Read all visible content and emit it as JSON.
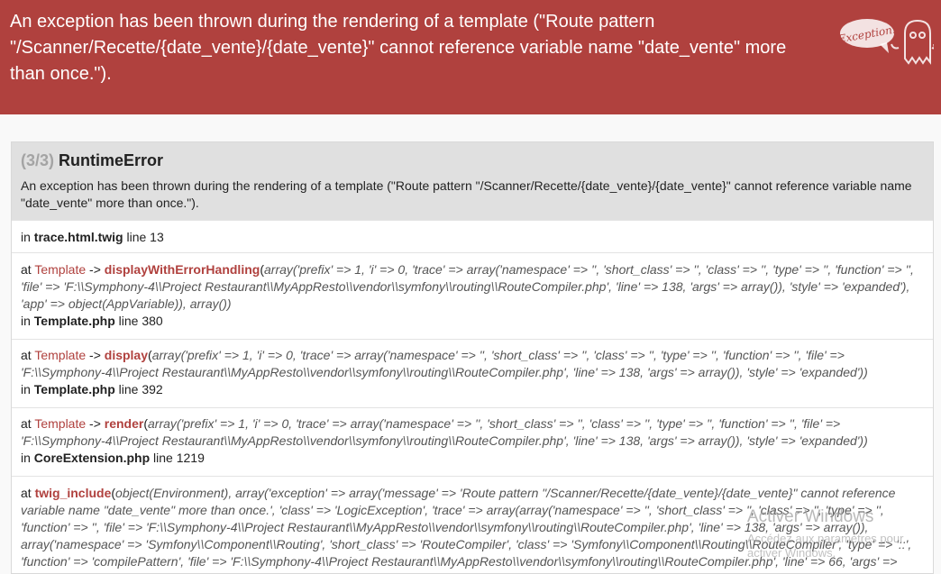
{
  "header": {
    "message": "An exception has been thrown during the rendering of a template (\"Route pattern \"/Scanner/Recette/{date_vente}/{date_vente}\" cannot reference variable name \"date_vente\" more than once.\").",
    "badge_text": "Exception!"
  },
  "trace": {
    "count": "(3/3)",
    "title": "RuntimeError",
    "message": "An exception has been thrown during the rendering of a template (\"Route pattern \"/Scanner/Recette/{date_vente}/{date_vente}\" cannot reference variable name \"date_vente\" more than once.\").",
    "first": {
      "in": "in",
      "file": "trace.html.twig",
      "line": "line 13"
    },
    "entries": [
      {
        "at": "at",
        "class": "Template",
        "arrow": " -> ",
        "function": "displayWithErrorHandling",
        "args_text": "array('prefix' => 1, 'i' => 0, 'trace' => array('namespace' => '', 'short_class' => '', 'class' => '', 'type' => '', 'function' => '', 'file' => 'F:\\\\Symphony-4\\\\Project Restaurant\\\\MyAppResto\\\\vendor\\\\symfony\\\\routing\\\\RouteCompiler.php', 'line' => 138, 'args' => array()), 'style' => 'expanded'), 'app' => object(AppVariable)), array())",
        "in": "in",
        "file": "Template.php",
        "line": "line 380"
      },
      {
        "at": "at",
        "class": "Template",
        "arrow": " -> ",
        "function": "display",
        "args_text": "array('prefix' => 1, 'i' => 0, 'trace' => array('namespace' => '', 'short_class' => '', 'class' => '', 'type' => '', 'function' => '', 'file' => 'F:\\\\Symphony-4\\\\Project Restaurant\\\\MyAppResto\\\\vendor\\\\symfony\\\\routing\\\\RouteCompiler.php', 'line' => 138, 'args' => array()), 'style' => 'expanded'))",
        "in": "in",
        "file": "Template.php",
        "line": "line 392"
      },
      {
        "at": "at",
        "class": "Template",
        "arrow": " -> ",
        "function": "render",
        "args_text": "array('prefix' => 1, 'i' => 0, 'trace' => array('namespace' => '', 'short_class' => '', 'class' => '', 'type' => '', 'function' => '', 'file' => 'F:\\\\Symphony-4\\\\Project Restaurant\\\\MyAppResto\\\\vendor\\\\symfony\\\\routing\\\\RouteCompiler.php', 'line' => 138, 'args' => array()), 'style' => 'expanded'))",
        "in": "in",
        "file": "CoreExtension.php",
        "line": "line 1219"
      },
      {
        "at": "at",
        "class": "",
        "arrow": "",
        "function": "twig_include",
        "args_text": "object(Environment), array('exception' => array('message' => 'Route pattern \"/Scanner/Recette/{date_vente}/{date_vente}\" cannot reference variable name \"date_vente\" more than once.', 'class' => 'LogicException', 'trace' => array(array('namespace' => '', 'short_class' => '', 'class' => '', 'type' => '', 'function' => '', 'file' => 'F:\\\\Symphony-4\\\\Project Restaurant\\\\MyAppResto\\\\vendor\\\\symfony\\\\routing\\\\RouteCompiler.php', 'line' => 138, 'args' => array()), array('namespace' => 'Symfony\\\\Component\\\\Routing', 'short_class' => 'RouteCompiler', 'class' => 'Symfony\\\\Component\\\\Routing\\\\RouteCompiler', 'type' => '::', 'function' => 'compilePattern', 'file' => 'F:\\\\Symphony-4\\\\Project Restaurant\\\\MyAppResto\\\\vendor\\\\symfony\\\\routing\\\\RouteCompiler.php', 'line' => 66, 'args' =>",
        "in": "",
        "file": "",
        "line": ""
      }
    ]
  },
  "watermark": {
    "title": "Activer Windows",
    "subtitle": "Accédez aux paramètres pour activer Windows."
  }
}
